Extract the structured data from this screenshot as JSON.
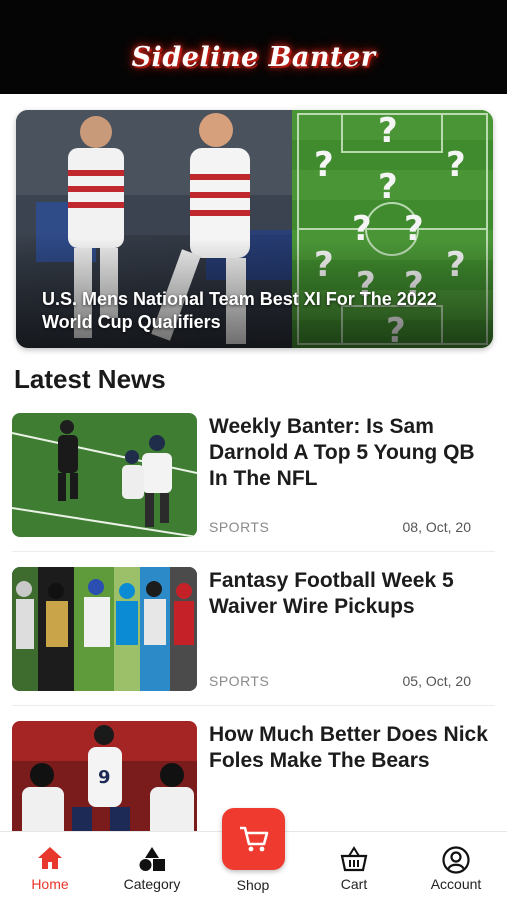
{
  "header": {
    "brand": "Sideline Banter"
  },
  "featured": {
    "title": "U.S. Mens National Team Best XI For The 2022 World Cup Qualifiers"
  },
  "latest": {
    "heading": "Latest News",
    "items": [
      {
        "title": "Weekly Banter: Is Sam Darnold A Top 5 Young QB In The NFL",
        "category": "SPORTS",
        "date": "08, Oct, 20"
      },
      {
        "title": "Fantasy Football Week 5 Waiver Wire Pickups",
        "category": "SPORTS",
        "date": "05, Oct, 20"
      },
      {
        "title": "How Much Better Does Nick Foles Make The Bears",
        "category": "",
        "date": ""
      }
    ]
  },
  "tabs": {
    "home": "Home",
    "category": "Category",
    "shop": "Shop",
    "cart": "Cart",
    "account": "Account"
  },
  "colors": {
    "accent": "#e8372c",
    "header_bg": "#050505",
    "field": "#3f8b2e"
  }
}
